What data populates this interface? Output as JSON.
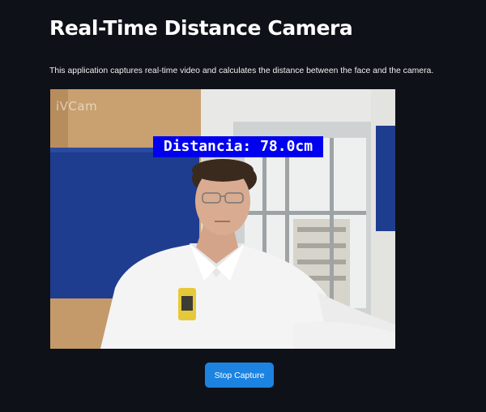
{
  "app": {
    "title": "Real-Time Distance Camera",
    "description": "This application captures real-time video and calculates the distance between the face and the camera."
  },
  "video": {
    "watermark": "iVCam",
    "overlay_label": "Distancia: 78.0cm"
  },
  "controls": {
    "stop_label": "Stop Capture"
  },
  "colors": {
    "background": "#0e1117",
    "accent_button": "#1c83e1",
    "overlay_box": "#0000ee"
  }
}
